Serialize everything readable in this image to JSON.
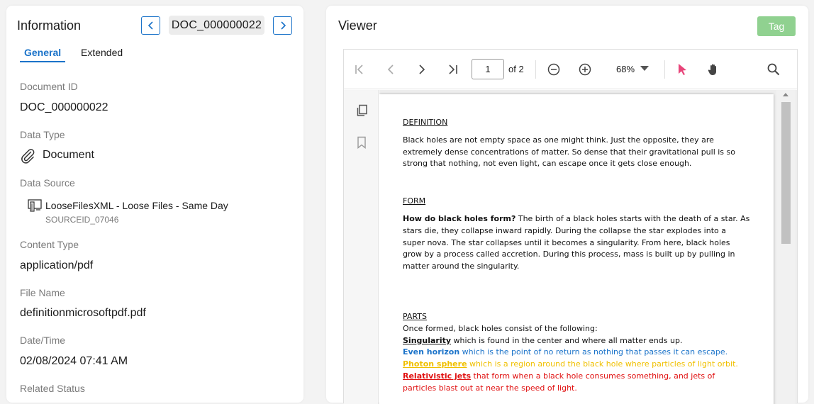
{
  "info_panel": {
    "title": "Information",
    "doc_id_chip": "DOC_000000022",
    "tabs": [
      {
        "label": "General",
        "active": true
      },
      {
        "label": "Extended",
        "active": false
      }
    ],
    "fields": {
      "document_id": {
        "label": "Document ID",
        "value": "DOC_000000022"
      },
      "data_type": {
        "label": "Data Type",
        "value": "Document",
        "icon": "paperclip-icon"
      },
      "data_source": {
        "label": "Data Source",
        "value": "LooseFilesXML - Loose Files - Same Day",
        "sub": "SOURCEID_07046",
        "icon": "monitor-files-icon"
      },
      "content_type": {
        "label": "Content Type",
        "value": "application/pdf"
      },
      "file_name": {
        "label": "File Name",
        "value": "definitionmicrosoftpdf.pdf"
      },
      "date_time": {
        "label": "Date/Time",
        "value": "02/08/2024 07:41 AM"
      },
      "related_status": {
        "label": "Related Status"
      }
    }
  },
  "viewer_panel": {
    "title": "Viewer",
    "tag_button": "Tag",
    "toolbar": {
      "page_current": "1",
      "page_of": "of 2",
      "zoom": "68%"
    },
    "document": {
      "definition_heading": "DEFINITION",
      "definition_text": "Black holes are not empty space as one might think.  Just the opposite, they are extremely dense concentrations of matter. So dense that their gravitational pull is so strong that nothing, not even light, can escape once it gets close enough.",
      "form_heading": "FORM",
      "form_question": "How do black holes form?",
      "form_text": " The birth of a black holes starts with the death of a star. As stars die, they collapse inward rapidly. During the collapse the star explodes into a super nova.  The star collapses until it becomes a singularity.  From here, black holes grow by a process called accretion. During this process, mass is built up by pulling in matter around the singularity.",
      "parts_heading": "PARTS",
      "parts_intro": "Once formed, black holes consist of the following:",
      "parts": [
        {
          "term": "Singularity",
          "desc": " which is found in the center and where all matter ends up.",
          "color": "#111111"
        },
        {
          "term": "Even horizon",
          "desc": " which is the point of no return as nothing that passes it can escape.",
          "color": "#1b73c9"
        },
        {
          "term": "Photon sphere",
          "desc": " which is a region around the black hole where particles of light orbit.",
          "color": "#f0c000"
        },
        {
          "term": "Relativistic jets",
          "desc": " that form when a black hole consumes something, and jets of particles blast out at near the speed of light.",
          "color": "#e01010"
        }
      ]
    }
  }
}
